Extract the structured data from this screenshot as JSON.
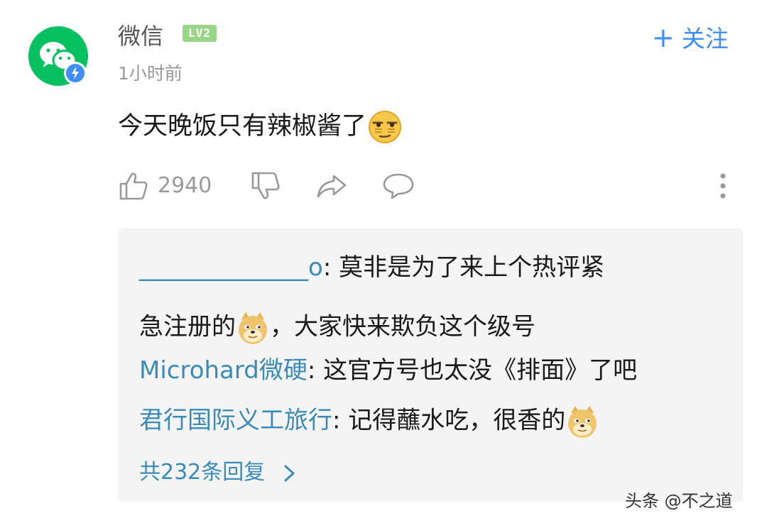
{
  "header": {
    "username": "微信",
    "level": "LV2",
    "timestamp": "1小时前",
    "follow_label": "关注"
  },
  "comment": {
    "text": "今天晚饭只有辣椒酱了",
    "emoji": "smirk-face"
  },
  "actions": {
    "like_count": "2940"
  },
  "replies": [
    {
      "author": "______________o",
      "text": ": 莫非是为了来上个热评紧",
      "emoji": ""
    },
    {
      "author": "",
      "text_before_emoji": "急注册的",
      "text": "，大家快来欺负这个级号",
      "emoji": "doge"
    },
    {
      "author": "Microhard微硬",
      "text": ": 这官方号也太没《排面》了吧",
      "emoji": ""
    },
    {
      "author": "君行国际义工旅行",
      "text": ": 记得蘸水吃，很香的",
      "emoji": "doge"
    }
  ],
  "more_replies_label": "共232条回复",
  "watermark": "头条 @不之道",
  "colors": {
    "brand_green": "#07c160",
    "accent_blue": "#3d8ff7",
    "reply_author": "#3a8bb8",
    "level_badge": "#9ad687"
  }
}
